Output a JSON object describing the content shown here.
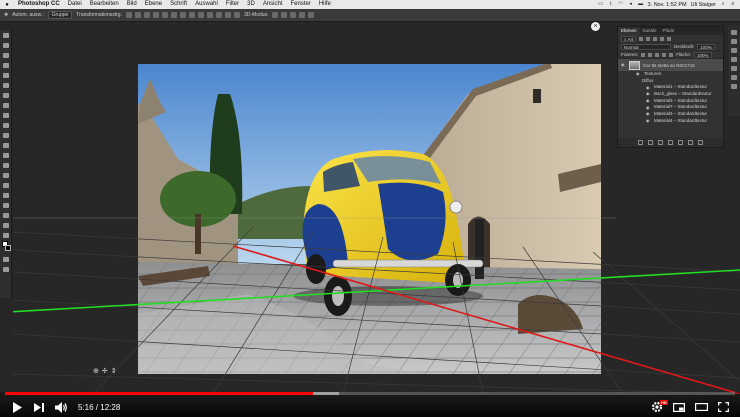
{
  "menubar": {
    "app_name": "Photoshop CC",
    "items": [
      "Datei",
      "Bearbeiten",
      "Bild",
      "Ebene",
      "Schrift",
      "Auswahl",
      "Filter",
      "3D",
      "Ansicht",
      "Fenster",
      "Hilfe"
    ],
    "clock": "3. Nov. 1:52 PM",
    "user": "Uli Staiger"
  },
  "options_bar": {
    "auto_select_label": "Autom. ausw.:",
    "auto_select_value": "Gruppe",
    "transform_label": "Transformationsstrg.",
    "mode_label": "3D-Modus:"
  },
  "layers_panel": {
    "tabs": [
      "Ebenen",
      "Kanäle",
      "Pfade"
    ],
    "filter_value": "Art",
    "blend_mode": "Normal",
    "opacity_label": "Deckkraft:",
    "opacity_value": "100%",
    "fix_label": "Fixieren:",
    "fill_label": "Fläche:",
    "fill_value": "100%",
    "main_layer": "Car 56 Isetta as NS01715",
    "textures_label": "Texturen",
    "diffuse_label": "Diffus",
    "materials": [
      "Material1 – Standardtextur",
      "Back_glass – Standardtextur",
      "Material3 – Standardtextur",
      "Material7 – Standardtextur",
      "Material3 – Standardtextur",
      "Material4 – Standardtextur"
    ]
  },
  "player": {
    "time_current": "5:16",
    "time_separator": " / ",
    "time_total": "12:28",
    "progress_fraction": 0.422,
    "buffer_fraction": 0.457,
    "hd_badge": "HD"
  },
  "colors": {
    "progress_red": "#ff0000",
    "grid_red": "#e01818",
    "grid_green": "#22dd22",
    "car_yellow": "#f2d214",
    "car_blue": "#1d3f8f"
  }
}
